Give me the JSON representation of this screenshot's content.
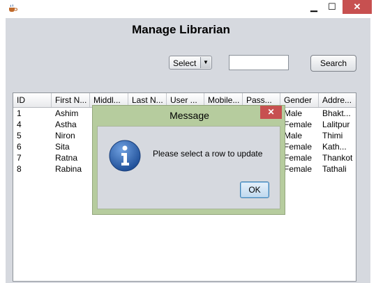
{
  "window": {
    "minimize_glyph": "▁",
    "maximize_glyph": "☐",
    "close_glyph": "✕",
    "app_icon": "java-coffee-icon"
  },
  "page": {
    "title": "Manage Librarian"
  },
  "toolbar": {
    "select_value": "Select",
    "search_value": "",
    "search_label": "Search"
  },
  "table": {
    "columns": [
      "ID",
      "First N...",
      "Middl...",
      "Last N...",
      "User ...",
      "Mobile...",
      "Pass...",
      "Gender",
      "Addre..."
    ],
    "rows": [
      {
        "id": "1",
        "first": "Ashim",
        "gender": "Male",
        "address": "Bhakt..."
      },
      {
        "id": "4",
        "first": "Astha",
        "gender": "Female",
        "address": "Lalitpur"
      },
      {
        "id": "5",
        "first": "Niron",
        "gender": "Male",
        "address": "Thimi"
      },
      {
        "id": "6",
        "first": "Sita",
        "gender": "Female",
        "address": "Kath..."
      },
      {
        "id": "7",
        "first": "Ratna",
        "gender": "Female",
        "address": "Thankot"
      },
      {
        "id": "8",
        "first": "Rabina",
        "gender": "Female",
        "address": "Tathali"
      }
    ]
  },
  "dialog": {
    "title": "Message",
    "close_glyph": "✕",
    "icon": "info-icon",
    "message": "Please select a row to update",
    "ok_label": "OK"
  },
  "colors": {
    "frame_bg": "#d6d9df",
    "dialog_border": "#b6cc9e",
    "close_red": "#c75050",
    "info_blue": "#2a5fa8"
  }
}
